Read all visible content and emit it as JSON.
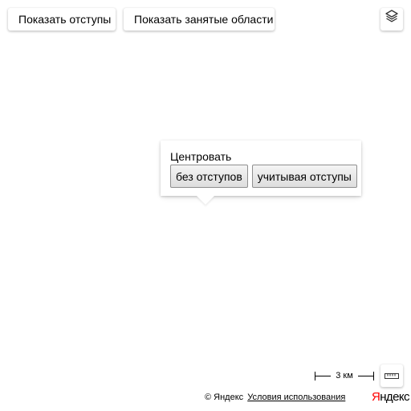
{
  "controls": {
    "show_offsets_label": "Показать отступы",
    "show_occupied_areas_label": "Показать занятые области"
  },
  "layers_icon": "layers-icon",
  "balloon": {
    "title": "Центровать",
    "button_without_offsets": "без отступов",
    "button_with_offsets": "учитывая отступы"
  },
  "scale": {
    "label": "3 км"
  },
  "ruler_icon": "ruler-icon",
  "copyrights": {
    "owner": "© Яндекс",
    "terms_link": "Условия использования"
  },
  "logo": {
    "first_letter": "Я",
    "rest": "ндекс"
  },
  "colors": {
    "logo_accent": "#ff0000",
    "icon_gray": "#333333"
  }
}
